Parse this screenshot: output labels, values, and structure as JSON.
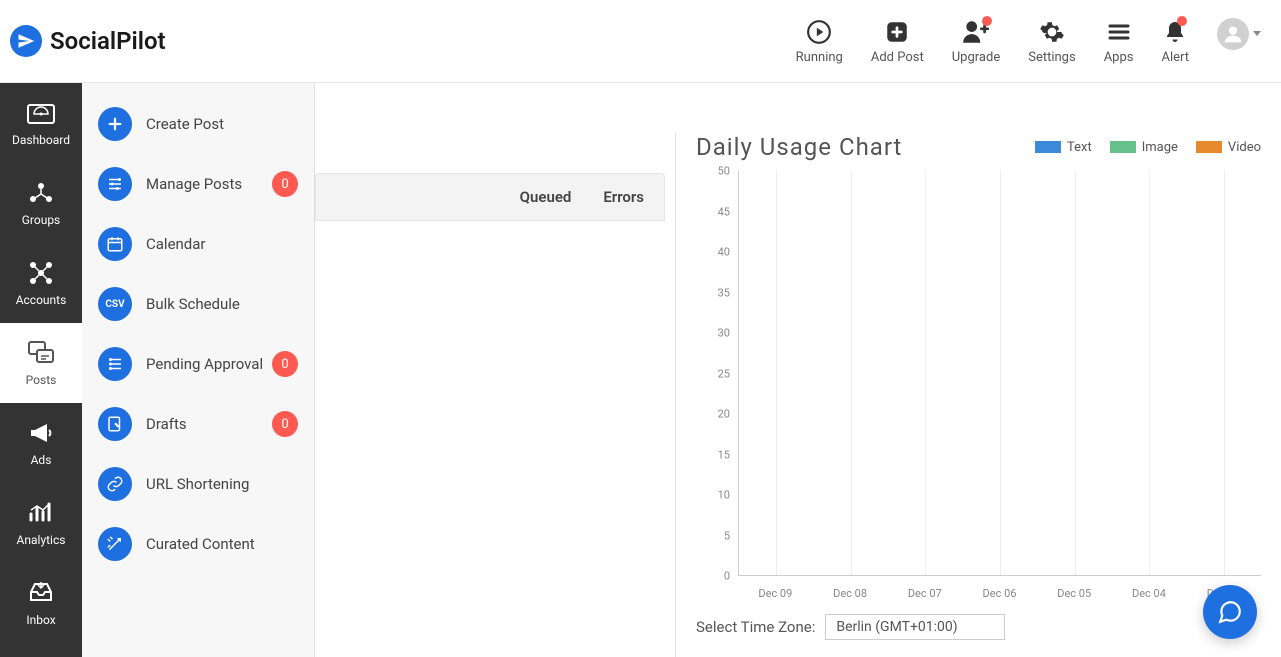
{
  "brand": {
    "name": "SocialPilot"
  },
  "header": {
    "actions": {
      "running": "Running",
      "add_post": "Add Post",
      "upgrade": "Upgrade",
      "settings": "Settings",
      "apps": "Apps",
      "alert": "Alert"
    }
  },
  "sidebar": {
    "dashboard": "Dashboard",
    "groups": "Groups",
    "accounts": "Accounts",
    "posts": "Posts",
    "ads": "Ads",
    "analytics": "Analytics",
    "inbox": "Inbox"
  },
  "flyout": {
    "create_post": "Create Post",
    "manage_posts": "Manage Posts",
    "manage_posts_badge": "0",
    "calendar": "Calendar",
    "bulk_schedule": "Bulk Schedule",
    "pending_approval": "Pending Approval",
    "pending_approval_badge": "0",
    "drafts": "Drafts",
    "drafts_badge": "0",
    "url_shortening": "URL Shortening",
    "curated_content": "Curated Content"
  },
  "tabs": {
    "queued": "Queued",
    "errors": "Errors"
  },
  "chart": {
    "title": "Daily Usage Chart",
    "legend": {
      "text": "Text",
      "image": "Image",
      "video": "Video"
    },
    "colors": {
      "text": "#3b8ad9",
      "image": "#66c18c",
      "video": "#e68a2e"
    }
  },
  "timezone": {
    "label": "Select Time Zone:",
    "value": "Berlin (GMT+01:00)"
  },
  "chart_data": {
    "type": "line",
    "title": "Daily Usage Chart",
    "xlabel": "",
    "ylabel": "",
    "ylim": [
      0,
      50
    ],
    "y_ticks": [
      0,
      5,
      10,
      15,
      20,
      25,
      30,
      35,
      40,
      45,
      50
    ],
    "categories": [
      "Dec 09",
      "Dec 08",
      "Dec 07",
      "Dec 06",
      "Dec 05",
      "Dec 04",
      "Dec 03"
    ],
    "series": [
      {
        "name": "Text",
        "values": [
          0,
          0,
          0,
          0,
          0,
          0,
          0
        ]
      },
      {
        "name": "Image",
        "values": [
          0,
          0,
          0,
          0,
          0,
          0,
          0
        ]
      },
      {
        "name": "Video",
        "values": [
          0,
          0,
          0,
          0,
          0,
          0,
          0
        ]
      }
    ]
  }
}
